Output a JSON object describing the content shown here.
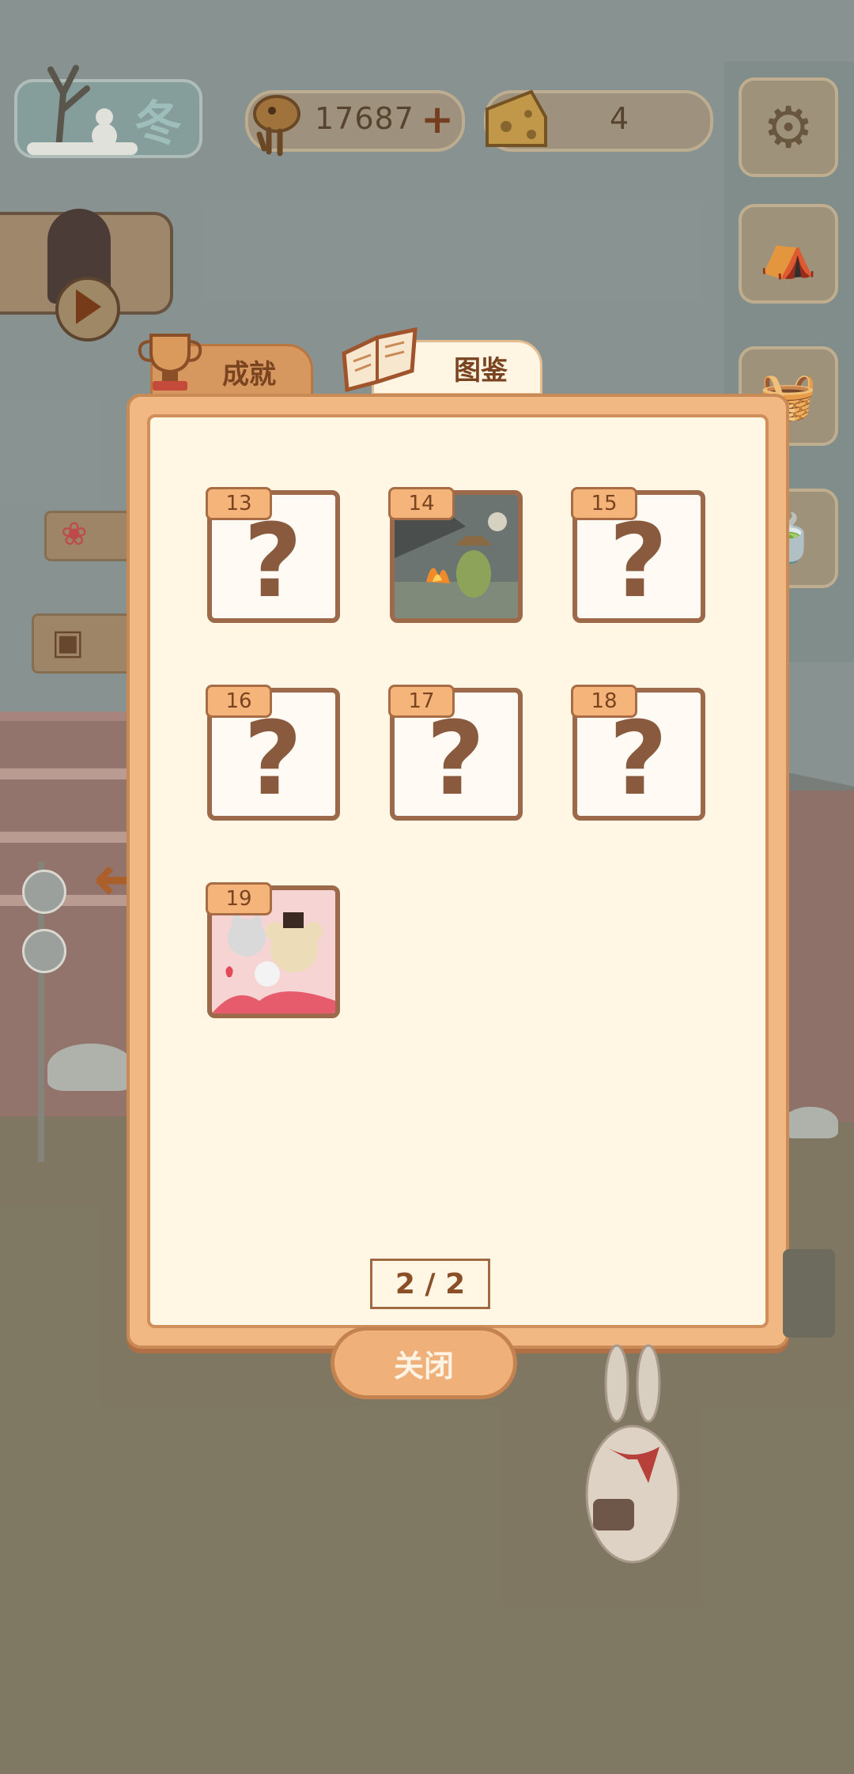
{
  "hud": {
    "season": "冬",
    "fish_count": "17687",
    "cheese_count": "4"
  },
  "tabs": {
    "achievements": "成就",
    "collection": "图鉴"
  },
  "cards": [
    {
      "num": "13",
      "unlocked": false,
      "mark": "?"
    },
    {
      "num": "14",
      "unlocked": true
    },
    {
      "num": "15",
      "unlocked": false,
      "mark": "?"
    },
    {
      "num": "16",
      "unlocked": false,
      "mark": "?"
    },
    {
      "num": "17",
      "unlocked": false,
      "mark": "?"
    },
    {
      "num": "18",
      "unlocked": false,
      "mark": "?"
    },
    {
      "num": "19",
      "unlocked": true
    }
  ],
  "pagination": "2 / 2",
  "close_label": "关闭",
  "colors": {
    "panel": "#f2b884",
    "panel_inner": "#fff6e4",
    "accent": "#b5632c",
    "card_border": "#9c6a4a"
  }
}
